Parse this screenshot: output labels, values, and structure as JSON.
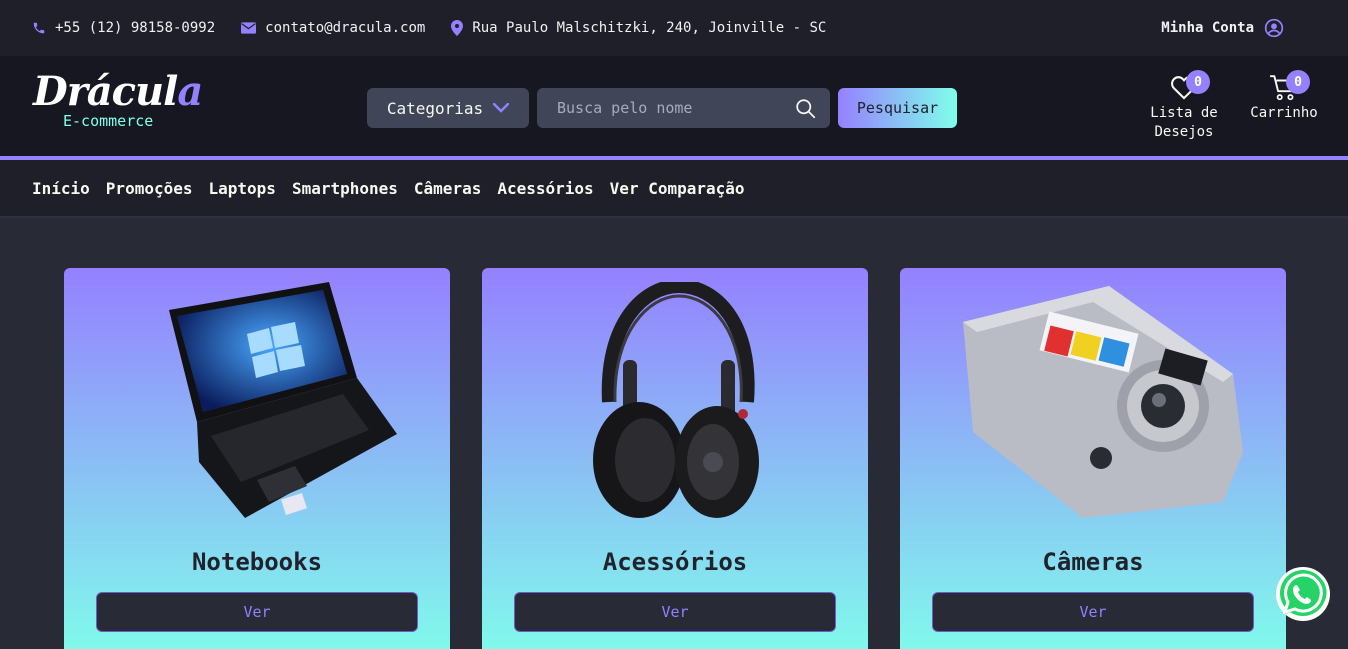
{
  "topbar": {
    "phone": "+55 (12) 98158-0992",
    "email": "contato@dracula.com",
    "address": "Rua Paulo Malschitzki, 240, Joinville - SC",
    "account": "Minha Conta"
  },
  "header": {
    "logo_main": "Drácul",
    "logo_accent": "a",
    "logo_sub": "E-commerce",
    "categories_label": "Categorias",
    "search_placeholder": "Busca pelo nome",
    "search_button": "Pesquisar",
    "wishlist_label_1": "Lista de",
    "wishlist_label_2": "Desejos",
    "wishlist_count": "0",
    "cart_label": "Carrinho",
    "cart_count": "0"
  },
  "nav": {
    "items": [
      "Início",
      "Promoções",
      "Laptops",
      "Smartphones",
      "Câmeras",
      "Acessórios",
      "Ver Comparação"
    ]
  },
  "cards": [
    {
      "title": "Notebooks",
      "button": "Ver",
      "icon": "laptop-image"
    },
    {
      "title": "Acessórios",
      "button": "Ver",
      "icon": "headphones-image"
    },
    {
      "title": "Câmeras",
      "button": "Ver",
      "icon": "camera-image"
    }
  ],
  "colors": {
    "purple": "#9580ff",
    "cyan": "#80ffea",
    "bg": "#282a36",
    "whatsapp": "#25d366"
  }
}
